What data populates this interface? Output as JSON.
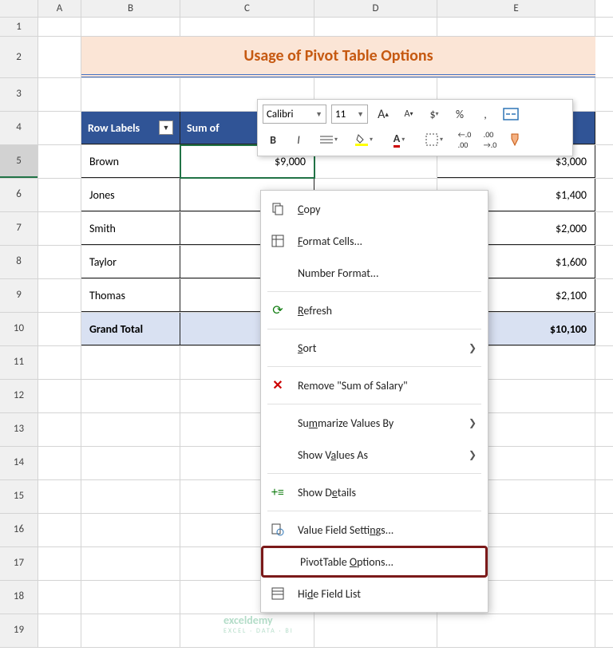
{
  "columns": [
    "A",
    "B",
    "C",
    "D",
    "E"
  ],
  "rows": [
    "1",
    "2",
    "3",
    "4",
    "5",
    "6",
    "7",
    "8",
    "9",
    "10",
    "11",
    "12",
    "13",
    "14",
    "15",
    "16",
    "17",
    "18",
    "19"
  ],
  "title": "Usage of Pivot Table Options",
  "headers": {
    "row_labels": "Row Labels",
    "sum_of": "Sum of"
  },
  "table": [
    {
      "label": "Brown",
      "c": "$9,000",
      "e": "$3,000"
    },
    {
      "label": "Jones",
      "c": "",
      "e": "$1,400"
    },
    {
      "label": "Smith",
      "c": "",
      "e": "$2,000"
    },
    {
      "label": "Taylor",
      "c": "",
      "e": "$1,600"
    },
    {
      "label": "Thomas",
      "c": "",
      "e": "$2,100"
    }
  ],
  "grand_total": {
    "label": "Grand Total",
    "c": "$",
    "e": "$10,100"
  },
  "toolbar": {
    "font": "Calibri",
    "size": "11",
    "increase_font": "A",
    "decrease_font": "A",
    "currency": "$",
    "percent": "%",
    "comma": ",",
    "bold": "B",
    "italic": "I",
    "dec_inc": ".00",
    "dec_dec": ".0"
  },
  "context_menu": {
    "copy": "Copy",
    "format_cells": "Format Cells...",
    "number_format": "Number Format...",
    "refresh": "Refresh",
    "sort": "Sort",
    "remove": "Remove \"Sum of Salary\"",
    "summarize": "Summarize Values By",
    "show_values": "Show Values As",
    "show_details": "Show Details",
    "value_field": "Value Field Settings...",
    "pivot_options": "PivotTable Options...",
    "hide_field": "Hide Field List"
  },
  "watermark": {
    "main": "exceldemy",
    "sub": "EXCEL · DATA · BI"
  }
}
